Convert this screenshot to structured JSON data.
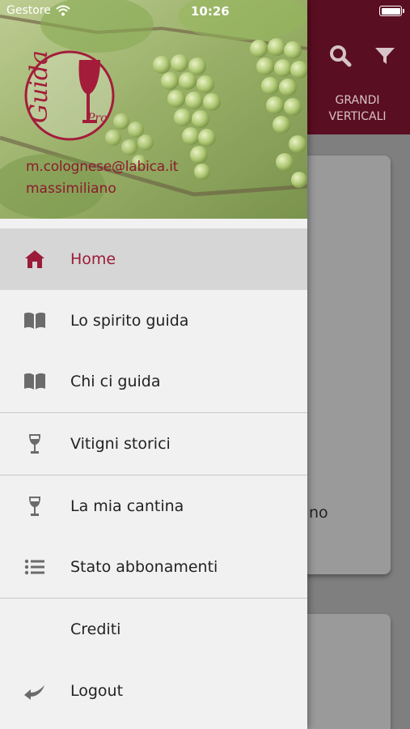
{
  "status_bar": {
    "carrier": "Gestore",
    "time": "10:26"
  },
  "background_app": {
    "tab_label_line1": "GRANDI",
    "tab_label_line2": "VERTICALI",
    "card_text": "no",
    "colors": {
      "topbar": "#5a0e22",
      "overlay": "#7f7f7f"
    }
  },
  "drawer": {
    "logo": {
      "text": "Guida",
      "subtext": "Pro"
    },
    "user": {
      "email": "m.colognese@labica.it",
      "name": "massimiliano"
    },
    "items": [
      {
        "label": "Home",
        "icon": "home-icon",
        "active": true
      },
      {
        "label": "Lo spirito guida",
        "icon": "book-icon"
      },
      {
        "label": "Chi ci guida",
        "icon": "book-icon"
      },
      {
        "label": "Vitigni storici",
        "icon": "wine-glass-icon"
      },
      {
        "label": "La mia cantina",
        "icon": "wine-glass-icon"
      },
      {
        "label": "Stato abbonamenti",
        "icon": "list-icon"
      },
      {
        "label": "Crediti",
        "icon": ""
      },
      {
        "label": "Logout",
        "icon": "logout-arrow-icon"
      }
    ],
    "colors": {
      "accent": "#9b1b39",
      "active_bg": "#d6d6d6",
      "bg": "#f1f1f1"
    }
  }
}
